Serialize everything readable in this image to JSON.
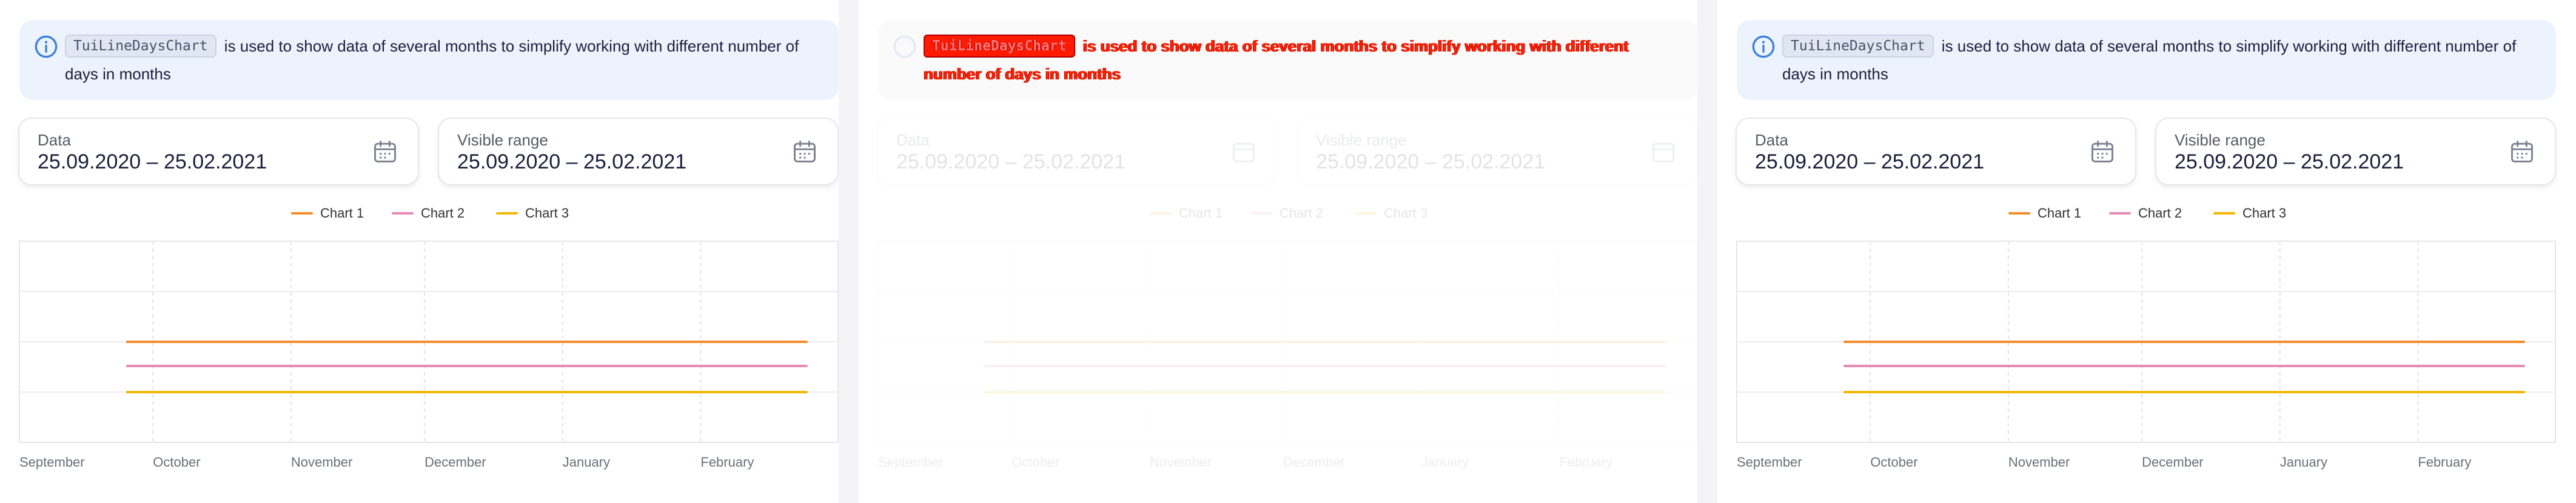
{
  "notice": {
    "component": "TuiLineDaysChart",
    "text": "is used to show data of several months to simplify working with different number of days in months"
  },
  "fields": {
    "data_label": "Data",
    "data_value": "25.09.2020 – 25.02.2021",
    "range_label": "Visible range",
    "range_value": "25.09.2020 – 25.02.2021"
  },
  "legend": [
    "Chart 1",
    "Chart 2",
    "Chart 3"
  ],
  "colors": {
    "accent_notice": "#ecf3fd",
    "chart1": "#f28c28",
    "chart2": "#e58ab2",
    "chart3": "#f2b705",
    "grid": "#e5e5ea"
  },
  "icons": [
    "info-icon",
    "calendar-icon"
  ],
  "chart_data": {
    "type": "line",
    "categories": [
      "September",
      "October",
      "November",
      "December",
      "January",
      "February"
    ],
    "series": [
      {
        "name": "Chart 1",
        "x": [
          "2020-09-25",
          "2021-02-25"
        ],
        "values": [
          50,
          50
        ]
      },
      {
        "name": "Chart 2",
        "x": [
          "2020-09-25",
          "2021-02-25"
        ],
        "values": [
          38,
          38
        ]
      },
      {
        "name": "Chart 3",
        "x": [
          "2020-09-25",
          "2021-02-25"
        ],
        "values": [
          25,
          25
        ]
      }
    ],
    "ylim": [
      0,
      100
    ],
    "grid": true
  }
}
